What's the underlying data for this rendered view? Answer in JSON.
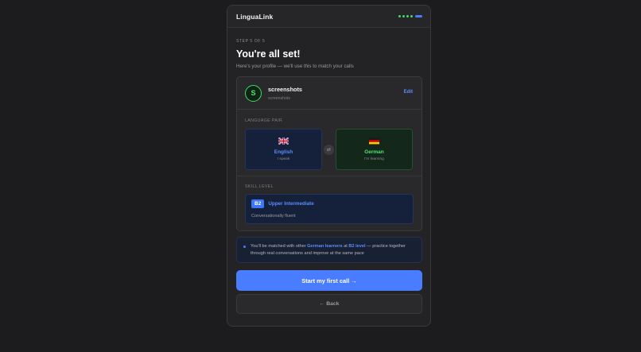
{
  "app": {
    "brand": "LinguaLink"
  },
  "progress": {
    "total_steps": 5,
    "current_step": 5,
    "colors": {
      "done": "#3ddc63",
      "current": "#4a7cff"
    }
  },
  "step_label": "STEP 5 OF 5",
  "title": "You're all set!",
  "subtitle": "Here's your profile — we'll use this to match your calls",
  "profile": {
    "avatar_letter": "S",
    "name": "screenshots",
    "handle": "screenshots",
    "edit_label": "Edit"
  },
  "language_pair": {
    "label": "LANGUAGE PAIR",
    "speak": {
      "flag_icon": "uk-flag-icon",
      "name": "English",
      "sub": "I speak",
      "color": "#5b8dff"
    },
    "swap_icon": "⇄",
    "learn": {
      "flag_icon": "germany-flag-icon",
      "name": "German",
      "sub": "I'm learning",
      "color": "#4ee671"
    }
  },
  "skill": {
    "label": "SKILL LEVEL",
    "badge": "B2",
    "level_name": "Upper Intermediate",
    "description": "Conversationally fluent"
  },
  "info": {
    "text_1": "You'll be matched with other ",
    "highlight_1": "German learners",
    "text_2": " at ",
    "highlight_2": "B2 level",
    "text_3": " — practice together through real conversations and improve at the same pace"
  },
  "buttons": {
    "primary": "Start my first call →",
    "back": "← Back"
  }
}
